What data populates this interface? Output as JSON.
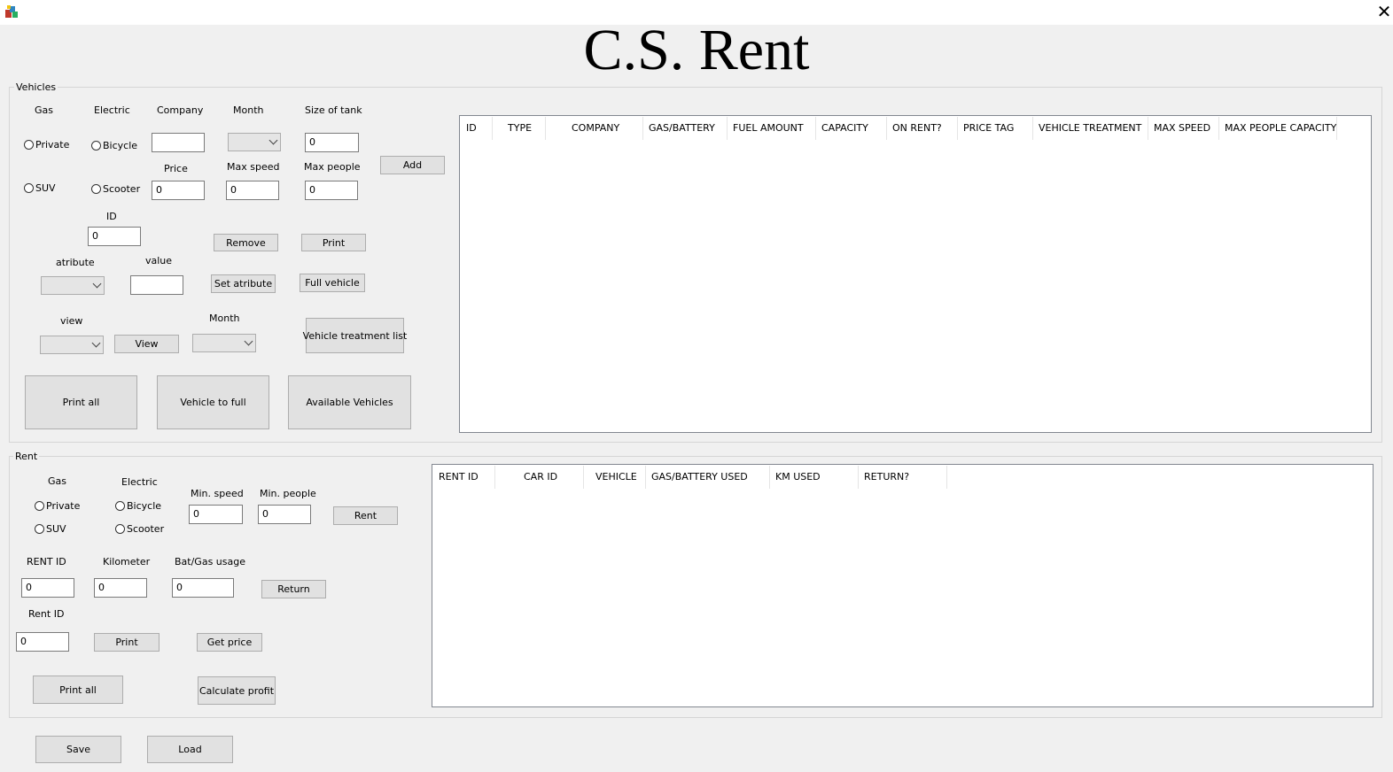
{
  "window": {
    "title": "C.S. Rent",
    "close_glyph": "✕",
    "app_icon": "app-icon"
  },
  "vehicles": {
    "group_label": "Vehicles",
    "gas_label": "Gas",
    "electric_label": "Electric",
    "company_label": "Company",
    "month_label": "Month",
    "size_of_tank_label": "Size of tank",
    "price_label": "Price",
    "max_speed_label": "Max speed",
    "max_people_label": "Max people",
    "id_label": "ID",
    "atribute_label": "atribute",
    "value_label": "value",
    "view_label": "view",
    "month2_label": "Month",
    "radio_private": "Private",
    "radio_suv": "SUV",
    "radio_bicycle": "Bicycle",
    "radio_scooter": "Scooter",
    "company_value": "",
    "size_of_tank_value": "0",
    "price_value": "0",
    "max_speed_value": "0",
    "max_people_value": "0",
    "id_value": "0",
    "value_value": "",
    "add_btn": "Add",
    "remove_btn": "Remove",
    "print_btn": "Print",
    "set_atribute_btn": "Set atribute",
    "full_vehicle_btn": "Full vehicle",
    "view_btn": "View",
    "vehicle_treatment_btn": "Vehicle treatment list",
    "print_all_btn": "Print all",
    "vehicle_to_full_btn": "Vehicle to full",
    "available_vehicles_btn": "Available Vehicles",
    "table_columns": [
      "ID",
      "TYPE",
      "COMPANY",
      "GAS/BATTERY",
      "FUEL AMOUNT",
      "CAPACITY",
      "ON RENT?",
      "PRICE TAG",
      "VEHICLE TREATMENT",
      "MAX SPEED",
      "MAX PEOPLE CAPACITY"
    ]
  },
  "rent": {
    "group_label": "Rent",
    "gas_label": "Gas",
    "electric_label": "Electric",
    "min_speed_label": "Min. speed",
    "min_people_label": "Min. people",
    "rent_id_label": "RENT ID",
    "kilometer_label": "Kilometer",
    "bat_gas_label": "Bat/Gas usage",
    "rent_id2_label": "Rent ID",
    "radio_private": "Private",
    "radio_suv": "SUV",
    "radio_bicycle": "Bicycle",
    "radio_scooter": "Scooter",
    "min_speed_value": "0",
    "min_people_value": "0",
    "rent_id_value": "0",
    "kilometer_value": "0",
    "bat_gas_value": "0",
    "rent_id2_value": "0",
    "rent_btn": "Rent",
    "return_btn": "Return",
    "print_btn": "Print",
    "get_price_btn": "Get price",
    "print_all_btn": "Print all",
    "calculate_profit_btn": "Calculate profit",
    "table_columns": [
      "RENT ID",
      "CAR ID",
      "VEHICLE",
      "GAS/BATTERY USED",
      "KM USED",
      "RETURN?"
    ]
  },
  "footer": {
    "save_btn": "Save",
    "load_btn": "Load"
  }
}
